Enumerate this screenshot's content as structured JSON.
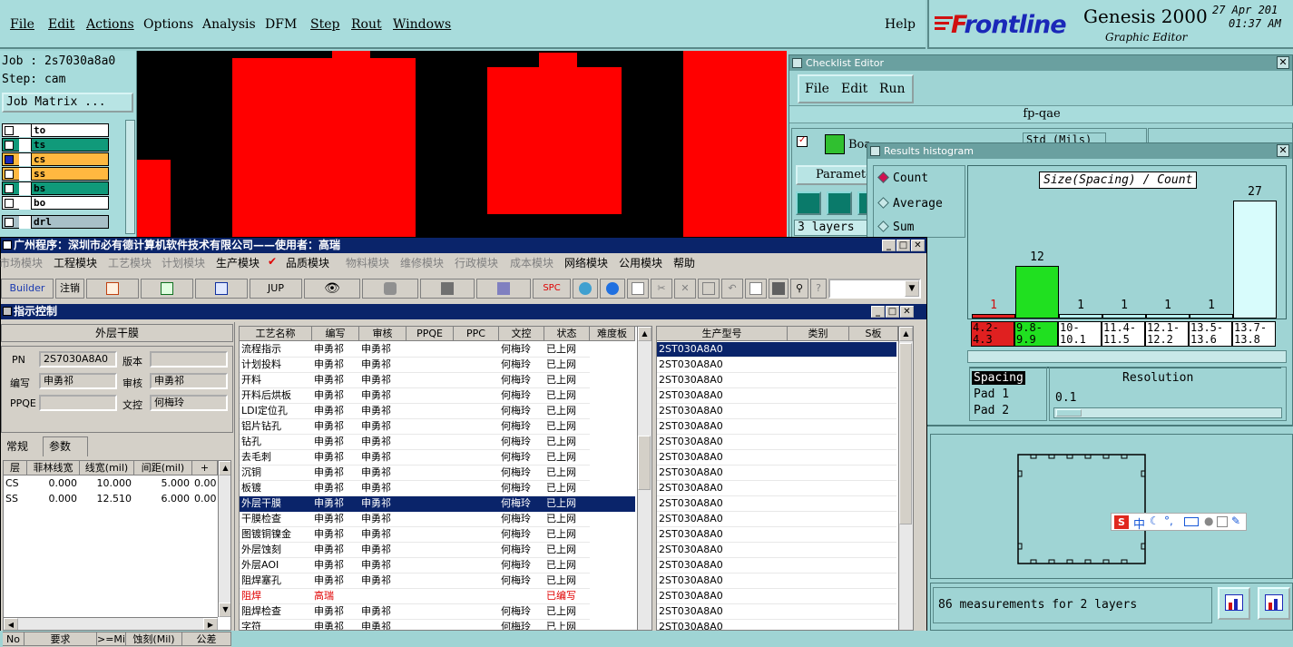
{
  "menu": {
    "file": "File",
    "edit": "Edit",
    "actions": "Actions",
    "options": "Options",
    "analysis": "Analysis",
    "dfm": "DFM",
    "step": "Step",
    "rout": "Rout",
    "windows": "Windows",
    "help": "Help"
  },
  "brand": {
    "logo_f": "F",
    "logo_rest": "rontline",
    "product": "Genesis 2000",
    "subtitle": "Graphic Editor",
    "date": "27 Apr 201",
    "time": "01:37 AM"
  },
  "job": {
    "job_line": "Job : 2s7030a8a0",
    "step_line": "Step: cam",
    "matrix_label": "Job Matrix ..."
  },
  "layers": [
    {
      "name": "to",
      "color": "#ffffff"
    },
    {
      "name": "ts",
      "color": "#109a7a"
    },
    {
      "name": "cs",
      "color": "#ffb840"
    },
    {
      "name": "ss",
      "color": "#ffb840"
    },
    {
      "name": "bs",
      "color": "#109a7a"
    },
    {
      "name": "bo",
      "color": "#ffffff"
    },
    {
      "name": "drl",
      "color": "#a8c0c8"
    }
  ],
  "checklist": {
    "title": "Checklist Editor",
    "menu_file": "File",
    "menu_edit": "Edit",
    "menu_run": "Run",
    "name": "fp-qae",
    "board_label": "Boa",
    "units": "Std (Mils)",
    "params": "Paramete",
    "layers": "3 layers"
  },
  "histogram": {
    "title": "Results histogram",
    "radio_count": "Count",
    "radio_average": "Average",
    "radio_sum": "Sum",
    "resolution_label": "Resolution",
    "resolution_value": "0.1",
    "list": [
      "Spacing",
      "Pad 1",
      "Pad 2"
    ]
  },
  "chart_data": {
    "type": "bar",
    "title": "Size(Spacing) / Count",
    "categories": [
      "4.2-\n4.3",
      "9.8-\n9.9",
      "10-\n10.1",
      "11.4-\n11.5",
      "12.1-\n12.2",
      "13.5-\n13.6",
      "13.7-\n13.8"
    ],
    "values": [
      1,
      12,
      1,
      1,
      1,
      1,
      27
    ],
    "colors": [
      "#e02020",
      "#20e020",
      "#b8f0f0",
      "#b8f0f0",
      "#b8f0f0",
      "#b8f0f0",
      "#d8fcfc"
    ],
    "ylim": [
      0,
      27
    ]
  },
  "status": {
    "measurements": "86 measurements for 2 layers"
  },
  "ime": {
    "s": "S",
    "zh": "中"
  },
  "app": {
    "title": "广州程序：深圳市必有德计算机软件技术有限公司——使用者：高瑞",
    "modules": [
      "市场模块",
      "工程模块",
      "工艺模块",
      "计划模块",
      "生产模块",
      "品质模块",
      "物料模块",
      "维修模块",
      "行政模块",
      "成本模块",
      "网络模块",
      "公用模块",
      "帮助"
    ],
    "builder": "Builder",
    "logout": "注销",
    "jup": "JUP",
    "spc": "SPC",
    "sub_title": "指示控制",
    "panel_title": "外层干膜",
    "pn_label": "PN",
    "pn_value": "2S7030A8A0",
    "ver_label": "版本",
    "ver_value": "",
    "writer_label": "编写",
    "writer_value": "申勇祁",
    "audit_label": "审核",
    "audit_value": "申勇祁",
    "ppqe_label": "PPQE",
    "ppqe_value": "",
    "wenkong_label": "文控",
    "wenkong_value": "何梅玲",
    "tab_normal": "常规",
    "tab_params": "参数",
    "ptable_headers": [
      "层",
      "菲林线宽",
      "线宽(mil)",
      "间距(mil)",
      "+"
    ],
    "ptable_rows": [
      [
        "CS",
        "0.000",
        "10.000",
        "5.000",
        "0.00"
      ],
      [
        "SS",
        "0.000",
        "12.510",
        "6.000",
        "0.00"
      ]
    ],
    "bottom_headers": [
      "No",
      "要求",
      ">=Mil",
      "蚀刻(Mil)",
      "公差"
    ],
    "proc_headers": [
      "工艺名称",
      "编写",
      "审核",
      "PPQE",
      "PPC",
      "文控",
      "状态",
      "难度板"
    ],
    "proc_rows": [
      [
        "流程指示",
        "申勇祁",
        "申勇祁",
        "",
        "",
        "何梅玲",
        "已上网"
      ],
      [
        "计划投料",
        "申勇祁",
        "申勇祁",
        "",
        "",
        "何梅玲",
        "已上网"
      ],
      [
        "开料",
        "申勇祁",
        "申勇祁",
        "",
        "",
        "何梅玲",
        "已上网"
      ],
      [
        "开料后烘板",
        "申勇祁",
        "申勇祁",
        "",
        "",
        "何梅玲",
        "已上网"
      ],
      [
        "LDI定位孔",
        "申勇祁",
        "申勇祁",
        "",
        "",
        "何梅玲",
        "已上网"
      ],
      [
        "铝片钻孔",
        "申勇祁",
        "申勇祁",
        "",
        "",
        "何梅玲",
        "已上网"
      ],
      [
        "钻孔",
        "申勇祁",
        "申勇祁",
        "",
        "",
        "何梅玲",
        "已上网"
      ],
      [
        "去毛刺",
        "申勇祁",
        "申勇祁",
        "",
        "",
        "何梅玲",
        "已上网"
      ],
      [
        "沉铜",
        "申勇祁",
        "申勇祁",
        "",
        "",
        "何梅玲",
        "已上网"
      ],
      [
        "板镀",
        "申勇祁",
        "申勇祁",
        "",
        "",
        "何梅玲",
        "已上网"
      ],
      [
        "外层干膜",
        "申勇祁",
        "申勇祁",
        "",
        "",
        "何梅玲",
        "已上网"
      ],
      [
        "干膜检查",
        "申勇祁",
        "申勇祁",
        "",
        "",
        "何梅玲",
        "已上网"
      ],
      [
        "图镀铜镍金",
        "申勇祁",
        "申勇祁",
        "",
        "",
        "何梅玲",
        "已上网"
      ],
      [
        "外层蚀刻",
        "申勇祁",
        "申勇祁",
        "",
        "",
        "何梅玲",
        "已上网"
      ],
      [
        "外层AOI",
        "申勇祁",
        "申勇祁",
        "",
        "",
        "何梅玲",
        "已上网"
      ],
      [
        "阻焊塞孔",
        "申勇祁",
        "申勇祁",
        "",
        "",
        "何梅玲",
        "已上网"
      ],
      [
        "阻焊",
        "高瑞",
        "",
        "",
        "",
        "",
        "已编写"
      ],
      [
        "阻焊检查",
        "申勇祁",
        "申勇祁",
        "",
        "",
        "何梅玲",
        "已上网"
      ],
      [
        "字符",
        "申勇祁",
        "申勇祁",
        "",
        "",
        "何梅玲",
        "已上网"
      ]
    ],
    "prod_headers": [
      "生产型号",
      "类别",
      "S板"
    ],
    "prod_value": "2ST030A8A0",
    "prod_count": 19
  }
}
